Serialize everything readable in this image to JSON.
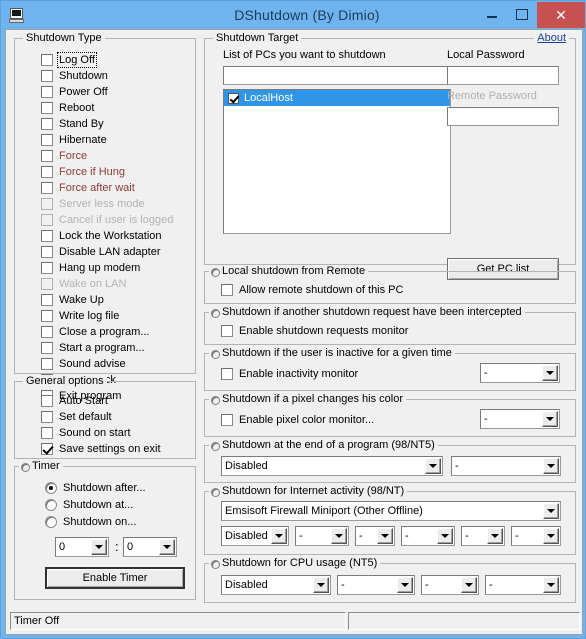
{
  "window": {
    "title": "DShutdown (By Dimio)",
    "icon": "computer-icon",
    "minimize_label": "",
    "maximize_label": "",
    "close_label": "✕",
    "close_color": "#c75050",
    "titlebar_color": "#6fb3ef"
  },
  "shutdown_type": {
    "title": "Shutdown Type",
    "items": [
      {
        "label": "Log Off",
        "checked": false,
        "state": "focused"
      },
      {
        "label": "Shutdown",
        "checked": false,
        "state": "normal"
      },
      {
        "label": "Power Off",
        "checked": false,
        "state": "normal"
      },
      {
        "label": "Reboot",
        "checked": false,
        "state": "normal"
      },
      {
        "label": "Stand By",
        "checked": false,
        "state": "normal"
      },
      {
        "label": "Hibernate",
        "checked": false,
        "state": "normal"
      },
      {
        "label": "Force",
        "checked": false,
        "state": "red"
      },
      {
        "label": "Force if Hung",
        "checked": false,
        "state": "red"
      },
      {
        "label": "Force after wait",
        "checked": false,
        "state": "red"
      },
      {
        "label": "Server less mode",
        "checked": false,
        "state": "disabled"
      },
      {
        "label": "Cancel if user is logged",
        "checked": false,
        "state": "disabled"
      },
      {
        "label": "Lock the Workstation",
        "checked": false,
        "state": "normal"
      },
      {
        "label": "Disable LAN adapter",
        "checked": false,
        "state": "normal"
      },
      {
        "label": "Hang up modem",
        "checked": false,
        "state": "normal"
      },
      {
        "label": "Wake on LAN",
        "checked": false,
        "state": "disabled"
      },
      {
        "label": "Wake Up",
        "checked": false,
        "state": "normal"
      },
      {
        "label": "Write log file",
        "checked": false,
        "state": "normal"
      },
      {
        "label": "Close a program...",
        "checked": false,
        "state": "normal"
      },
      {
        "label": "Start a program...",
        "checked": false,
        "state": "normal"
      },
      {
        "label": "Sound advise",
        "checked": false,
        "state": "normal"
      },
      {
        "label": "Alarm clock",
        "checked": false,
        "state": "normal"
      },
      {
        "label": "Exit program",
        "checked": false,
        "state": "normal"
      }
    ]
  },
  "general_options": {
    "title": "General options",
    "items": [
      {
        "label": "Auto Start",
        "checked": false
      },
      {
        "label": "Set default",
        "checked": false
      },
      {
        "label": "Sound on start",
        "checked": false
      },
      {
        "label": "Save settings on exit",
        "checked": true
      }
    ]
  },
  "timer": {
    "title": "Timer",
    "radios": [
      {
        "label": "Shutdown after...",
        "selected": true
      },
      {
        "label": "Shutdown at...",
        "selected": false
      },
      {
        "label": "Shutdown on...",
        "selected": false
      }
    ],
    "hours_value": "0",
    "minutes_value": "0",
    "separator": ":",
    "enable_button": "Enable Timer"
  },
  "shutdown_target": {
    "title": "Shutdown Target",
    "about_link": "About",
    "pc_list_label": "List of PCs you want to shutdown",
    "pc_input_value": "",
    "pc_list": [
      {
        "label": "LocalHost",
        "checked": true,
        "selected": true
      }
    ],
    "local_password_label": "Local Password",
    "local_password_value": "",
    "remote_password_label": "Remote Password",
    "remote_password_value": "",
    "remote_password_disabled": true,
    "get_pc_list_button": "Get PC list"
  },
  "local_remote": {
    "title": "Local shutdown from Remote",
    "checkbox_label": "Allow remote shutdown of this PC",
    "checked": false
  },
  "intercept": {
    "title": "Shutdown if another shutdown request have been intercepted",
    "checkbox_label": "Enable shutdown requests monitor",
    "checked": false
  },
  "inactivity": {
    "title": "Shutdown if the user is inactive for a given time",
    "checkbox_label": "Enable inactivity monitor",
    "checked": false,
    "combo_value": "-"
  },
  "pixel_color": {
    "title": "Shutdown if a pixel changes his color",
    "checkbox_label": "Enable pixel color monitor...",
    "checked": false,
    "combo_value": "-"
  },
  "end_of_program": {
    "title": "Shutdown at the end of a program (98/NT5)",
    "combo1_value": "Disabled",
    "combo2_value": "-"
  },
  "internet_activity": {
    "title": "Shutdown for Internet activity (98/NT)",
    "adapter_value": "Emsisoft Firewall Miniport (Other Offline)",
    "combos": [
      "Disabled",
      "-",
      "-",
      "-",
      "-",
      "-"
    ]
  },
  "cpu_usage": {
    "title": "Shutdown for CPU usage (NT5)",
    "combos": [
      "Disabled",
      "-",
      "-",
      "-"
    ]
  },
  "status_bar": {
    "left_text": "Timer Off",
    "right_text": ""
  }
}
